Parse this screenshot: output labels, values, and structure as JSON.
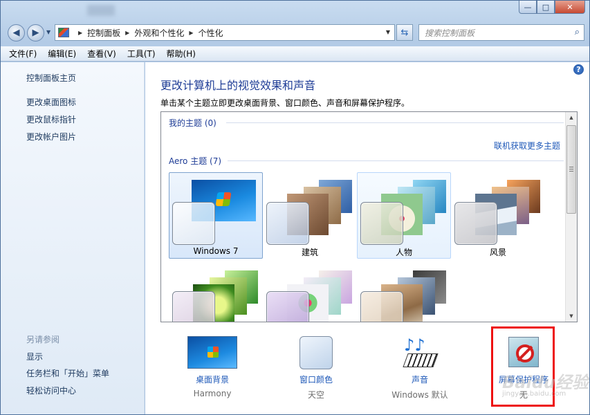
{
  "window": {
    "controls": {
      "minimize": "—",
      "maximize": "□",
      "close": "✕"
    }
  },
  "address": {
    "breadcrumbs": [
      "控制面板",
      "外观和个性化",
      "个性化"
    ],
    "search_placeholder": "搜索控制面板"
  },
  "menu": [
    "文件(F)",
    "编辑(E)",
    "查看(V)",
    "工具(T)",
    "帮助(H)"
  ],
  "sidebar": {
    "home": "控制面板主页",
    "links": [
      "更改桌面图标",
      "更改鼠标指针",
      "更改帐户图片"
    ],
    "see_also_title": "另请参阅",
    "see_also": [
      "显示",
      "任务栏和「开始」菜单",
      "轻松访问中心"
    ]
  },
  "main": {
    "heading": "更改计算机上的视觉效果和声音",
    "subheading": "单击某个主题立即更改桌面背景、窗口颜色、声音和屏幕保护程序。",
    "my_themes_label": "我的主题 (0)",
    "online_link": "联机获取更多主题",
    "aero_label": "Aero 主题 (7)",
    "themes": [
      {
        "name": "Windows 7",
        "state": "selected"
      },
      {
        "name": "建筑",
        "state": "normal"
      },
      {
        "name": "人物",
        "state": "hover"
      },
      {
        "name": "风景",
        "state": "normal"
      },
      {
        "name": "",
        "state": "normal"
      },
      {
        "name": "",
        "state": "normal"
      },
      {
        "name": "",
        "state": "normal"
      }
    ],
    "bottom": [
      {
        "label": "桌面背景",
        "value": "Harmony",
        "icon": "desktop-background-icon"
      },
      {
        "label": "窗口颜色",
        "value": "天空",
        "icon": "window-color-icon"
      },
      {
        "label": "声音",
        "value": "Windows 默认",
        "icon": "sound-icon"
      },
      {
        "label": "屏幕保护程序",
        "value": "无",
        "icon": "screensaver-icon"
      }
    ]
  },
  "watermark": {
    "main": "Baidu经验",
    "sub": "jingyan.baidu.com"
  },
  "colors": {
    "link": "#1e58b8",
    "heading": "#1e3c96",
    "highlight_box": "#ee1111"
  }
}
